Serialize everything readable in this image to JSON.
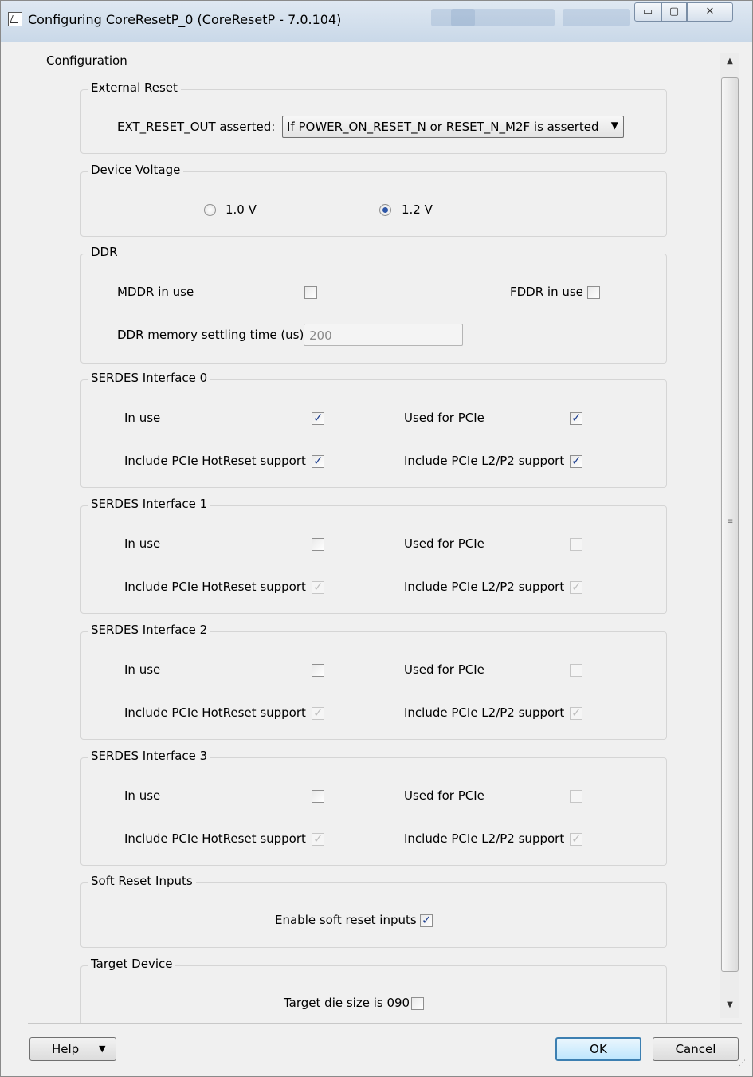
{
  "window": {
    "title": "Configuring CoreResetP_0 (CoreResetP - 7.0.104)",
    "controls": {
      "minimize": "▭",
      "maximize": "▢",
      "close": "✕"
    }
  },
  "config_label": "Configuration",
  "external_reset": {
    "title": "External Reset",
    "label": "EXT_RESET_OUT asserted:",
    "selected": "If POWER_ON_RESET_N or RESET_N_M2F is asserted"
  },
  "device_voltage": {
    "title": "Device Voltage",
    "option_1": "1.0 V",
    "option_2": "1.2 V",
    "selected": "1.2 V"
  },
  "ddr": {
    "title": "DDR",
    "mddr_label": "MDDR in use",
    "fddr_label": "FDDR in use",
    "settling_label": "DDR memory settling time (us):",
    "settling_value": "200"
  },
  "serdes": [
    {
      "title": "SERDES Interface 0",
      "in_use": "In use",
      "used_pcie": "Used for PCIe",
      "hotreset": "Include PCIe HotReset support",
      "l2p2": "Include PCIe L2/P2 support"
    },
    {
      "title": "SERDES Interface 1",
      "in_use": "In use",
      "used_pcie": "Used for PCIe",
      "hotreset": "Include PCIe HotReset support",
      "l2p2": "Include PCIe L2/P2 support"
    },
    {
      "title": "SERDES Interface 2",
      "in_use": "In use",
      "used_pcie": "Used for PCIe",
      "hotreset": "Include PCIe HotReset support",
      "l2p2": "Include PCIe L2/P2 support"
    },
    {
      "title": "SERDES Interface 3",
      "in_use": "In use",
      "used_pcie": "Used for PCIe",
      "hotreset": "Include PCIe HotReset support",
      "l2p2": "Include PCIe L2/P2 support"
    }
  ],
  "soft_reset": {
    "title": "Soft Reset Inputs",
    "label": "Enable soft reset inputs"
  },
  "target_device": {
    "title": "Target Device",
    "label": "Target die size is 090"
  },
  "buttons": {
    "help": "Help",
    "ok": "OK",
    "cancel": "Cancel"
  },
  "icons": {
    "check": "✓",
    "caret_down": "▼",
    "scroll_up": "▲",
    "scroll_down": "▼",
    "grip": "≡",
    "resize": "⋰"
  },
  "colors": {
    "accent": "#2f57a8",
    "ok_border": "#3c7fb1"
  }
}
